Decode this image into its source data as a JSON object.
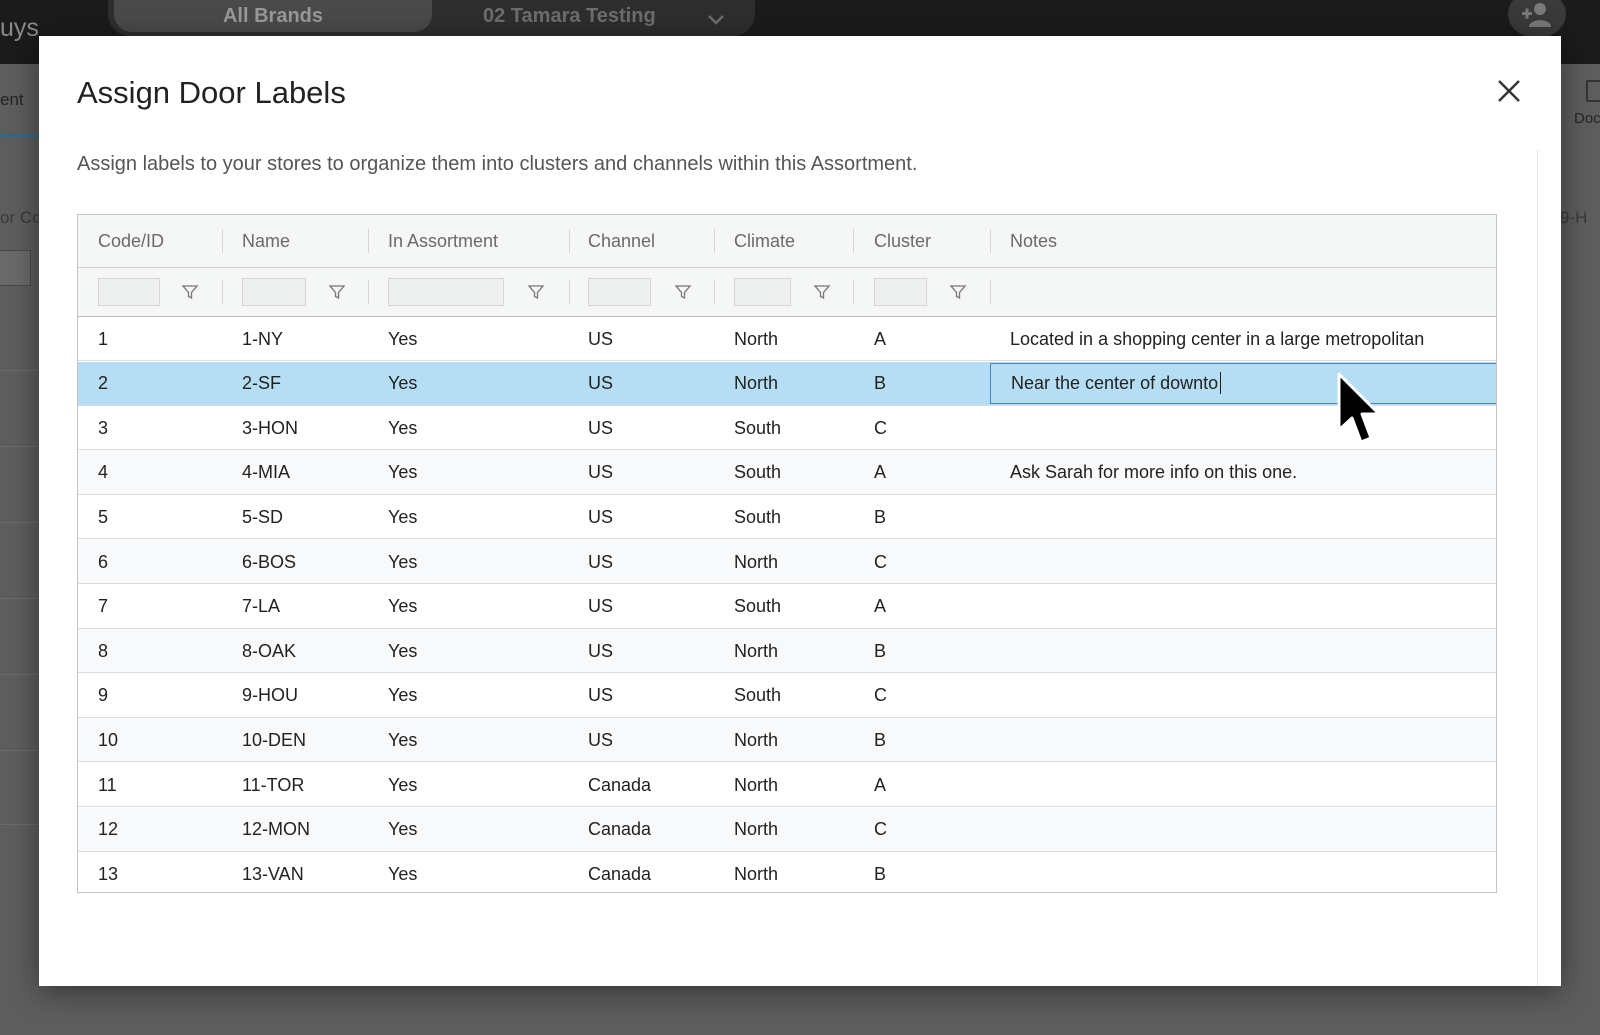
{
  "background": {
    "brand_fragment": "uys",
    "brand_selector": {
      "active_label": "All Brands",
      "other_label": "02 Tamara Testing"
    },
    "left_tab_fragment": "ent",
    "left_column_fragment": "or Co",
    "right_doc_fragment": "Doc",
    "right_column_fragment": "9-H"
  },
  "modal": {
    "title": "Assign Door Labels",
    "description": "Assign labels to your stores to organize them into clusters and channels within this Assortment."
  },
  "table": {
    "columns": [
      "Code/ID",
      "Name",
      "In Assortment",
      "Channel",
      "Climate",
      "Cluster",
      "Notes"
    ],
    "selected_row_index": 1,
    "editing_notes_value": "Near the center of downto",
    "rows": [
      {
        "code": "1",
        "name": "1-NY",
        "in_assortment": "Yes",
        "channel": "US",
        "climate": "North",
        "cluster": "A",
        "notes": "Located in a shopping center in a large metropolitan"
      },
      {
        "code": "2",
        "name": "2-SF",
        "in_assortment": "Yes",
        "channel": "US",
        "climate": "North",
        "cluster": "B",
        "notes": ""
      },
      {
        "code": "3",
        "name": "3-HON",
        "in_assortment": "Yes",
        "channel": "US",
        "climate": "South",
        "cluster": "C",
        "notes": ""
      },
      {
        "code": "4",
        "name": "4-MIA",
        "in_assortment": "Yes",
        "channel": "US",
        "climate": "South",
        "cluster": "A",
        "notes": "Ask Sarah for more info on this one."
      },
      {
        "code": "5",
        "name": "5-SD",
        "in_assortment": "Yes",
        "channel": "US",
        "climate": "South",
        "cluster": "B",
        "notes": ""
      },
      {
        "code": "6",
        "name": "6-BOS",
        "in_assortment": "Yes",
        "channel": "US",
        "climate": "North",
        "cluster": "C",
        "notes": ""
      },
      {
        "code": "7",
        "name": "7-LA",
        "in_assortment": "Yes",
        "channel": "US",
        "climate": "South",
        "cluster": "A",
        "notes": ""
      },
      {
        "code": "8",
        "name": "8-OAK",
        "in_assortment": "Yes",
        "channel": "US",
        "climate": "North",
        "cluster": "B",
        "notes": ""
      },
      {
        "code": "9",
        "name": "9-HOU",
        "in_assortment": "Yes",
        "channel": "US",
        "climate": "South",
        "cluster": "C",
        "notes": ""
      },
      {
        "code": "10",
        "name": "10-DEN",
        "in_assortment": "Yes",
        "channel": "US",
        "climate": "North",
        "cluster": "B",
        "notes": ""
      },
      {
        "code": "11",
        "name": "11-TOR",
        "in_assortment": "Yes",
        "channel": "Canada",
        "climate": "North",
        "cluster": "A",
        "notes": ""
      },
      {
        "code": "12",
        "name": "12-MON",
        "in_assortment": "Yes",
        "channel": "Canada",
        "climate": "North",
        "cluster": "C",
        "notes": ""
      },
      {
        "code": "13",
        "name": "13-VAN",
        "in_assortment": "Yes",
        "channel": "Canada",
        "climate": "North",
        "cluster": "B",
        "notes": ""
      }
    ]
  },
  "icons": {
    "close": "close-icon",
    "filter": "filter-icon",
    "chevron": "chevron-down-icon",
    "add_user": "add-user-icon",
    "cursor": "mouse-pointer-icon"
  },
  "colors": {
    "selected_row": "#b5def4",
    "editor_border": "#3f88c5",
    "header_bg": "#f5f6f6"
  }
}
